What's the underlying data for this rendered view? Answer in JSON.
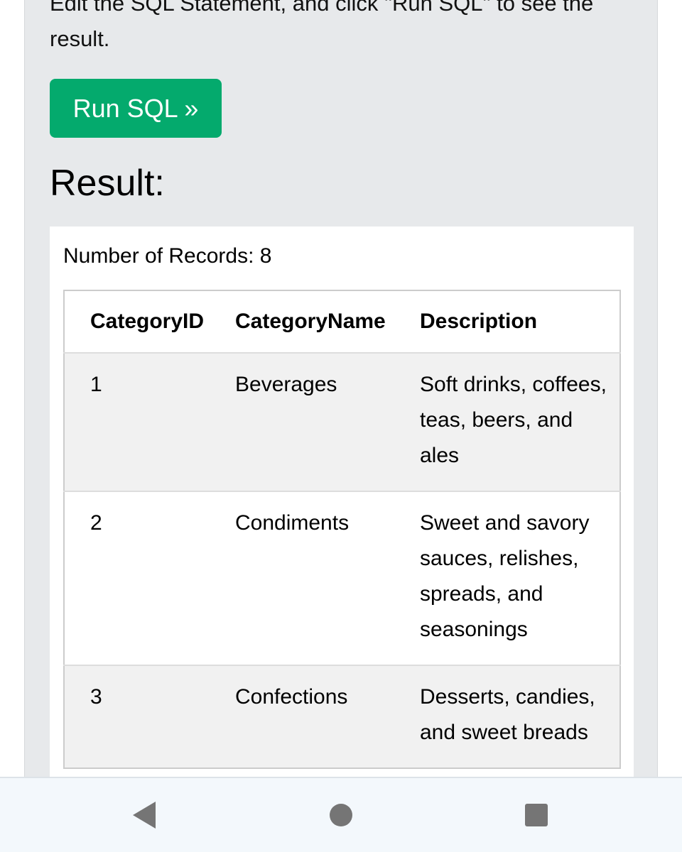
{
  "instruction": {
    "line1": "Edit the SQL Statement, and click \"Run SQL\" to see the",
    "line2": "result."
  },
  "run_button": {
    "label": "Run SQL »"
  },
  "result": {
    "heading": "Result:",
    "records_label": "Number of Records: 8",
    "columns": [
      "CategoryID",
      "CategoryName",
      "Description"
    ],
    "rows": [
      {
        "id": "1",
        "name": "Beverages",
        "description": "Soft drinks, coffees, teas, beers, and ales"
      },
      {
        "id": "2",
        "name": "Condiments",
        "description": "Sweet and savory sauces, relishes, spreads, and seasonings"
      },
      {
        "id": "3",
        "name": "Confections",
        "description": "Desserts, candies, and sweet breads"
      }
    ]
  },
  "colors": {
    "button_green": "#04aa6d",
    "panel_gray": "#e7e9eb",
    "nav_icon_gray": "#757575"
  },
  "nav_bar": {
    "icons": [
      "back-triangle-icon",
      "home-circle-icon",
      "recents-square-icon"
    ]
  }
}
